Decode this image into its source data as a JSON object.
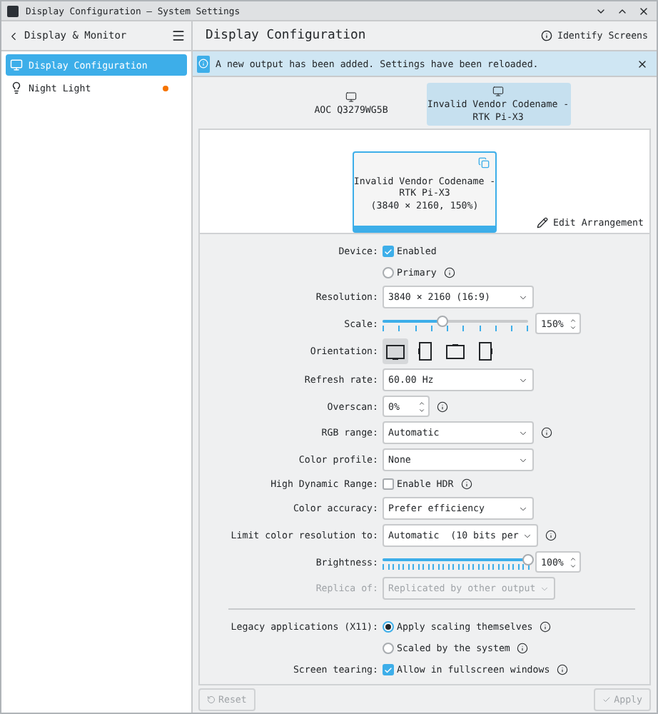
{
  "window": {
    "title": "Display Configuration — System Settings"
  },
  "sidebar": {
    "back_label": "Display & Monitor",
    "items": [
      {
        "label": "Display Configuration",
        "selected": true,
        "attention": false
      },
      {
        "label": "Night Light",
        "selected": false,
        "attention": true
      }
    ]
  },
  "page": {
    "title": "Display Configuration",
    "identify_button": "Identify Screens"
  },
  "banner": {
    "message": "A new output has been added. Settings have been reloaded."
  },
  "outputs": [
    {
      "label": "AOC Q3279WG5B",
      "selected": false
    },
    {
      "label": "Invalid Vendor Codename -\nRTK Pi-X3",
      "selected": true
    }
  ],
  "preview": {
    "label": "Invalid Vendor Codename -\nRTK Pi-X3\n(3840 × 2160, 150%)",
    "edit_button": "Edit Arrangement"
  },
  "form": [
    {
      "kind": "checkbox",
      "label": "Device:",
      "text": "Enabled",
      "checked": true
    },
    {
      "kind": "radio",
      "text": "Primary",
      "selected": false,
      "info": true
    },
    {
      "kind": "combo",
      "label": "Resolution:",
      "value": "3840 × 2160 (16:9)",
      "disabled": false
    },
    {
      "kind": "slider",
      "label": "Scale:",
      "level": 0.41,
      "reading": "150%"
    },
    {
      "kind": "orientation",
      "label": "Orientation:",
      "options": [
        {
          "selected": true
        },
        {
          "selected": false
        },
        {
          "selected": false
        },
        {
          "selected": false
        }
      ]
    },
    {
      "kind": "combo",
      "label": "Refresh rate:",
      "value": "60.00 Hz",
      "disabled": false
    },
    {
      "kind": "spin",
      "label": "Overscan:",
      "value": "0%",
      "info": true
    },
    {
      "kind": "combo",
      "label": "RGB range:",
      "value": "Automatic",
      "info": true,
      "disabled": false
    },
    {
      "kind": "combo",
      "label": "Color profile:",
      "value": "None",
      "disabled": false
    },
    {
      "kind": "checkbox",
      "label": "High Dynamic Range:",
      "text": "Enable HDR",
      "checked": false,
      "info": true
    },
    {
      "kind": "combo",
      "label": "Color accuracy:",
      "value": "Prefer efficiency",
      "disabled": false
    },
    {
      "kind": "combo",
      "label": "Limit color resolution to:",
      "value": "Automatic  (10 bits per",
      "info": true,
      "disabled": false
    },
    {
      "kind": "slider",
      "label": "Brightness:",
      "level": 1,
      "reading": "100%"
    },
    {
      "kind": "combo",
      "label": "Replica of:",
      "value": "Replicated by other output",
      "disabled": true
    },
    {
      "kind": "divider"
    },
    {
      "kind": "radio",
      "label": "Legacy applications (X11):",
      "text": "Apply scaling themselves",
      "selected": true,
      "info": true
    },
    {
      "kind": "radio",
      "text": "Scaled by the system",
      "selected": false,
      "info": true
    },
    {
      "kind": "checkbox",
      "label": "Screen tearing:",
      "text": "Allow in fullscreen windows",
      "checked": true,
      "info": true
    }
  ],
  "footer": {
    "reset": {
      "label": "Reset",
      "disabled": true
    },
    "apply": {
      "label": "Apply",
      "disabled": true
    }
  }
}
